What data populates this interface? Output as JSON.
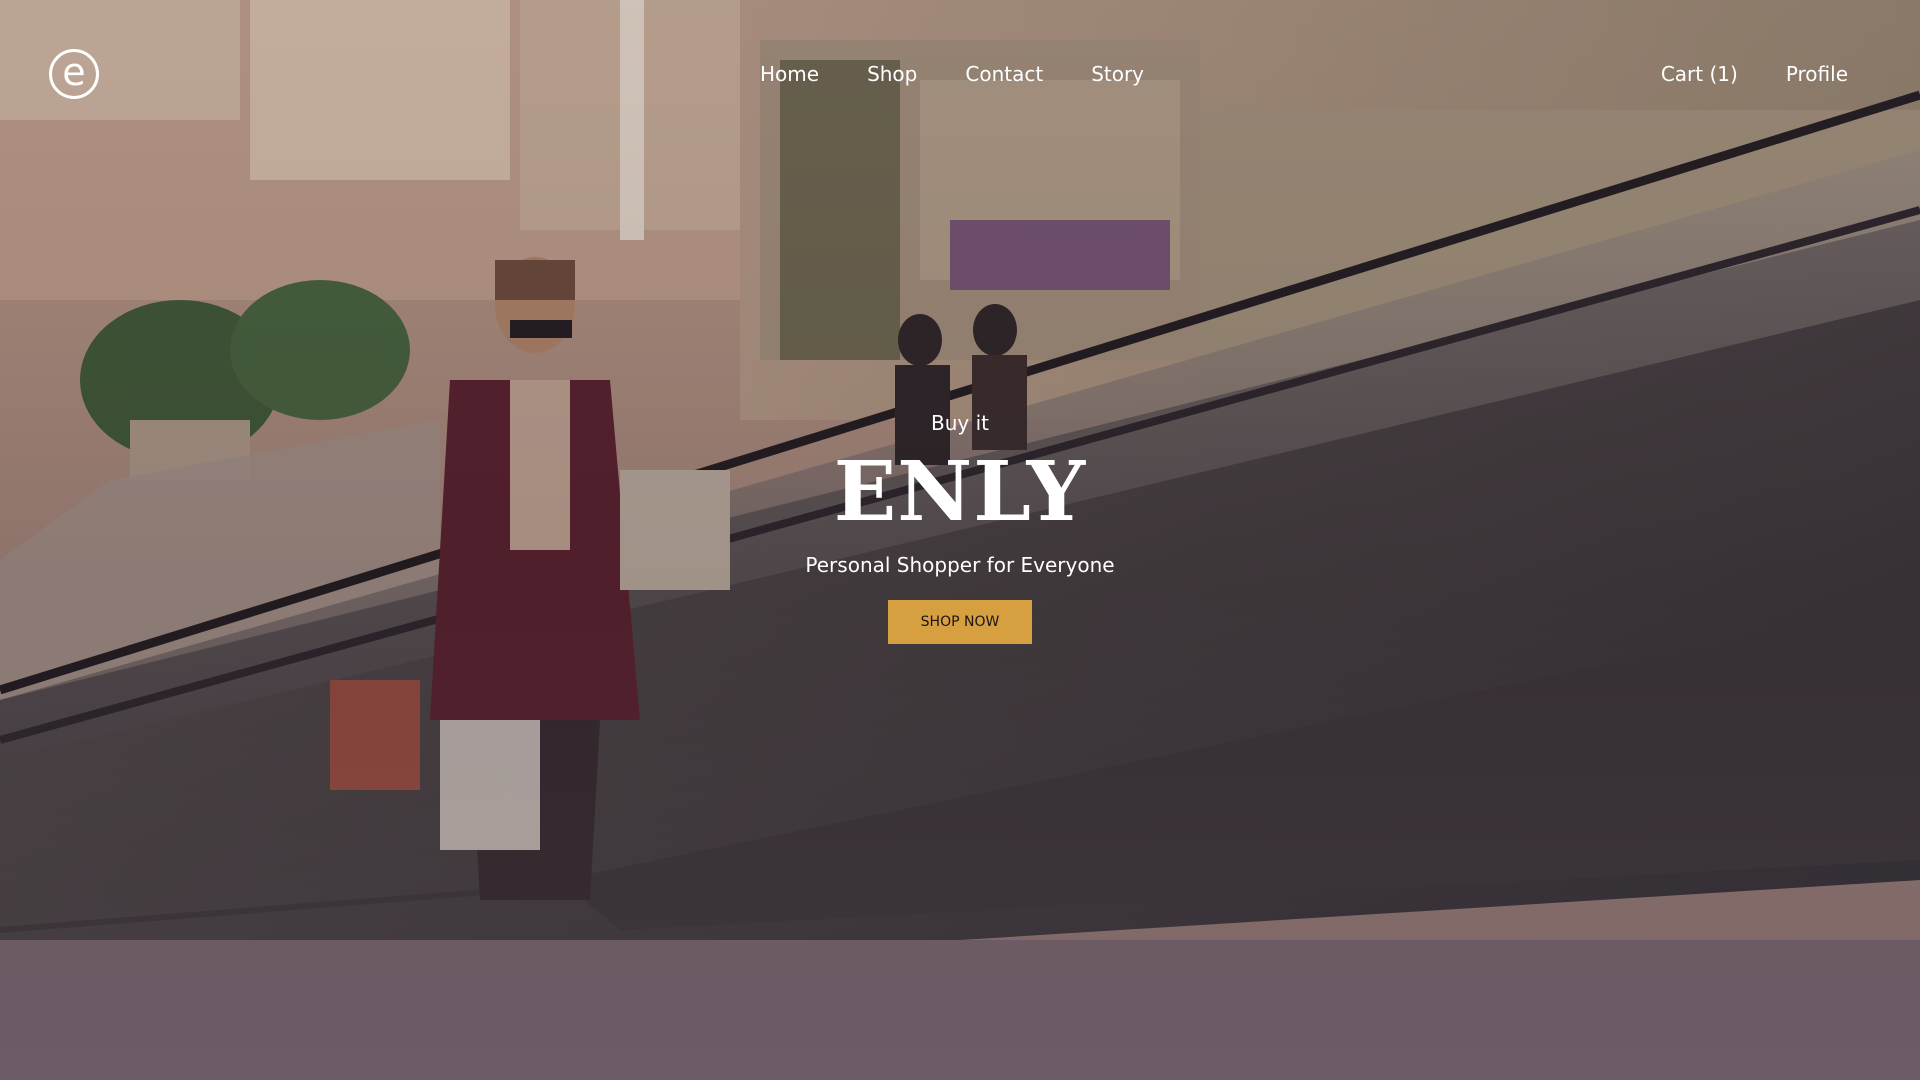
{
  "header": {
    "logo_letter": "e",
    "nav": [
      "Home",
      "Shop",
      "Contact",
      "Story"
    ],
    "cart_label": "Cart (1)",
    "profile_label": "Profile"
  },
  "hero": {
    "eyebrow": "Buy it",
    "title": "ENLY",
    "tagline": "Personal Shopper for Everyone",
    "cta_label": "SHOP NOW",
    "image_subject": "shopper-on-mall-escalator-photo"
  },
  "colors": {
    "accent": "#d6a040",
    "text": "#ffffff"
  }
}
